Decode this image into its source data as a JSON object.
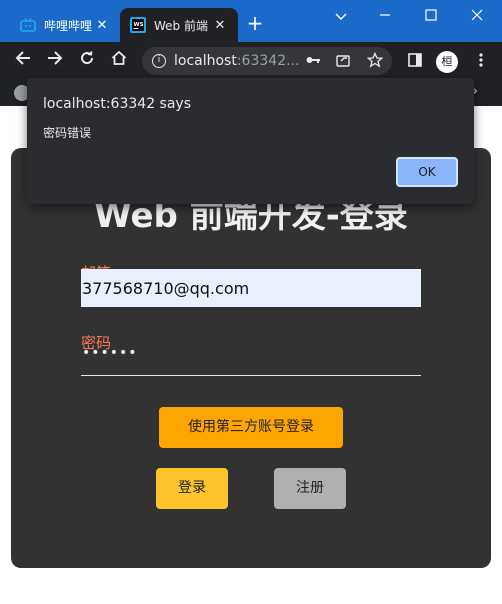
{
  "browser": {
    "tabs": [
      {
        "title": "哔哩哔哩",
        "active": false,
        "icon": "bilibili-icon"
      },
      {
        "title": "Web 前端",
        "active": true,
        "icon": "webstorm-icon"
      }
    ],
    "new_tab_label": "+",
    "url_host": "localhost",
    "url_rest": ":63342...",
    "profile_initial": "桓",
    "colors": {
      "titlebar": "#1b6ac9",
      "toolbar": "#202124",
      "bilibili": "#23ade5"
    }
  },
  "dialog": {
    "title": "localhost:63342 says",
    "message": "密码错误",
    "ok_label": "OK"
  },
  "login": {
    "title": "Web 前端开发-登录",
    "email_label": "邮箱",
    "email_value": "377568710@qq.com",
    "password_label": "密码",
    "password_mask": "••••••",
    "third_party_label": "使用第三方账号登录",
    "login_label": "登录",
    "register_label": "注册",
    "colors": {
      "card": "#323232",
      "label": "#ff7c57",
      "third_party": "#ffa500",
      "login": "#fdc42b",
      "register": "#b0b0b0"
    }
  }
}
